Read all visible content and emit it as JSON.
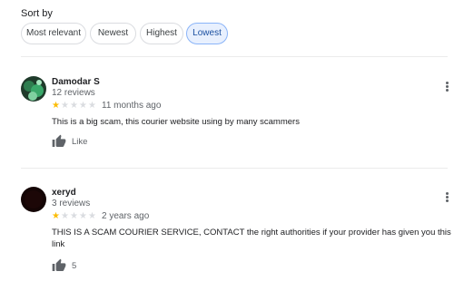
{
  "sort": {
    "label": "Sort by",
    "options": [
      "Most relevant",
      "Newest",
      "Highest",
      "Lowest"
    ],
    "selected": "Lowest"
  },
  "reviews": [
    {
      "name": "Damodar S",
      "review_count": "12 reviews",
      "rating": 1,
      "max_rating": 5,
      "time": "11 months ago",
      "text": "This is a big scam, this courier website using by many scammers",
      "like_label": "Like"
    },
    {
      "name": "xeryd",
      "review_count": "3 reviews",
      "rating": 1,
      "max_rating": 5,
      "time": "2 years ago",
      "text": "THIS IS A SCAM COURIER SERVICE, CONTACT the right authorities if your provider has given you this link",
      "like_label": "5"
    }
  ],
  "colors": {
    "star_filled": "#fbbc04",
    "star_empty": "#dadce0",
    "chip_active_bg": "#e8f0fe",
    "chip_active_text": "#1a4fa0"
  },
  "icons": {
    "like": "thumbs-up-icon",
    "menu": "more-vert-icon"
  }
}
